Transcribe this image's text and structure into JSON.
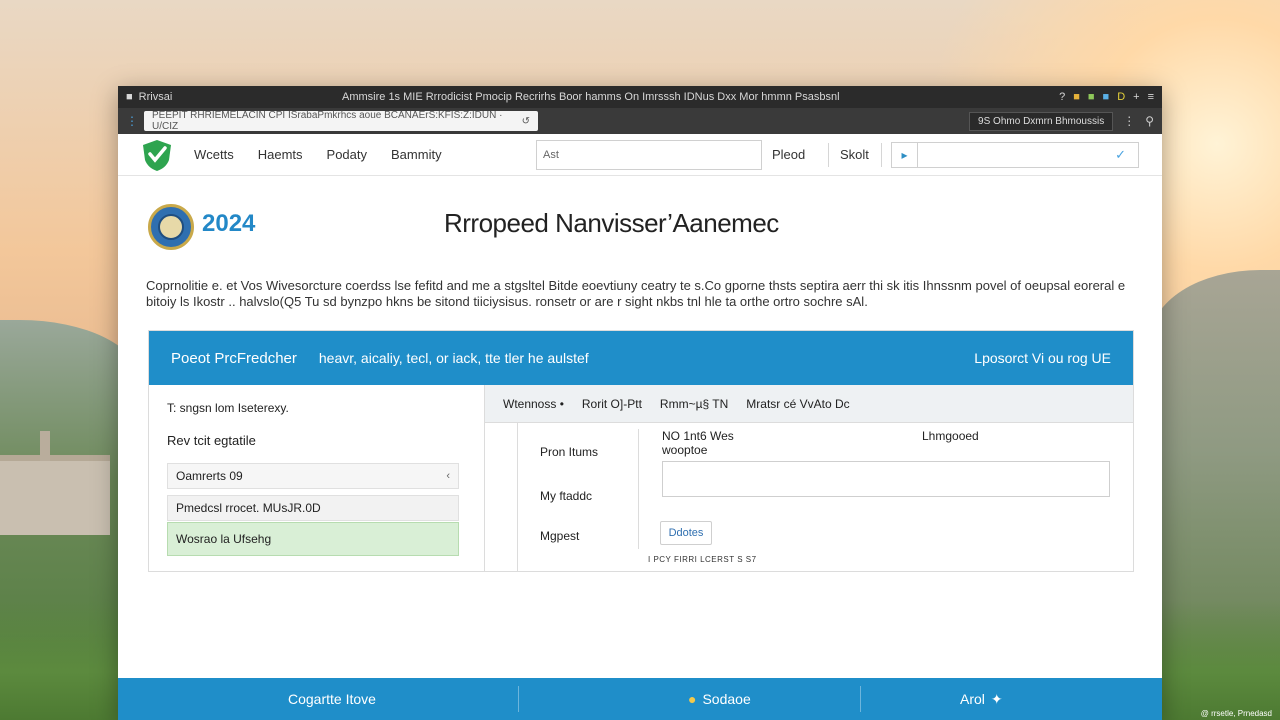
{
  "browser": {
    "tab_title": "Rrivsai",
    "window_title": "Ammsire 1s  MIE  Rrrodicist  Pmocip  Recrirhs  Boor hamms  On Imrsssh IDNus Dxx  Mor  hmmn  Psasbsnl",
    "address": "PEEPIT RHRIEMELACIN CPI ISrabaPmkrhcs aoue BCANAErS:KFIS:Z:IDUN · U/CIZ",
    "account": "9S  Ohmo  Dxmrn Bhmoussis",
    "icons": [
      "?",
      "■",
      "■",
      "■",
      "D",
      "+",
      "≡"
    ]
  },
  "nav": {
    "links": [
      "Wcetts",
      "Haemts",
      "Podaty",
      "Bammity"
    ],
    "search_placeholder": "Ast",
    "find": "Pleod",
    "shell": "Skolt"
  },
  "header": {
    "year": "2024",
    "title": "Rrropeed Nanvisser’Aanemec",
    "intro": "Coprnolitie e. et Vos Wivesorcture coerdss lse fefitd and me a stgsltel Bitde eoevtiuny ceatry te s.Co gporne thsts septira aerr thi sk itis Ihnssnm povel of oeupsal eoreral e bitoiy ls Ikostr .. halvslo(Q5 Tu sd bynzpo hkns be sitond tiiciysisus. ronsetr or are r sight nkbs tnl hle ta orthe ortro sochre sAl."
  },
  "panel": {
    "header_left": "Poeot PrcFredcher",
    "header_mid": "heavr, aicaliy, tecl, or iack, tte tler he aulstef",
    "header_right": "Lposorct Vi ou rog UE",
    "left": {
      "heading": "T: sngsn lom Iseterexy.",
      "label": "Rev tcit egtatile",
      "select_value": "Oamrerts 09",
      "field_value": "Pmedcsl rrocet. MUsJR.0D",
      "green_value": "Wosrao la Ufsehg"
    },
    "right": {
      "tabs": [
        "Wtennoss •",
        "Rorit O]-Ptt",
        "Rmm~µ§ TN",
        "Mratsr cé VvAto Dc"
      ],
      "label_1": "Pron Itums",
      "label_2": "My ftaddc",
      "label_3": "Mgpest",
      "field_title": "NO 1nt6 Wes",
      "field_subtitle": "wooptoe",
      "field_right": "Lhmgooed",
      "button": "Ddotes",
      "note": "I PCY FIRRI LCERST S S7"
    }
  },
  "footer": {
    "left": "Cogartte Itove",
    "mid": "Sodaoe",
    "right": "Arol"
  },
  "watermark": "@ rrsetle, Prnedasd",
  "colors": {
    "accent": "#1f8ec9",
    "success_bg": "#d9efd6",
    "logo_green": "#2ea44f"
  }
}
